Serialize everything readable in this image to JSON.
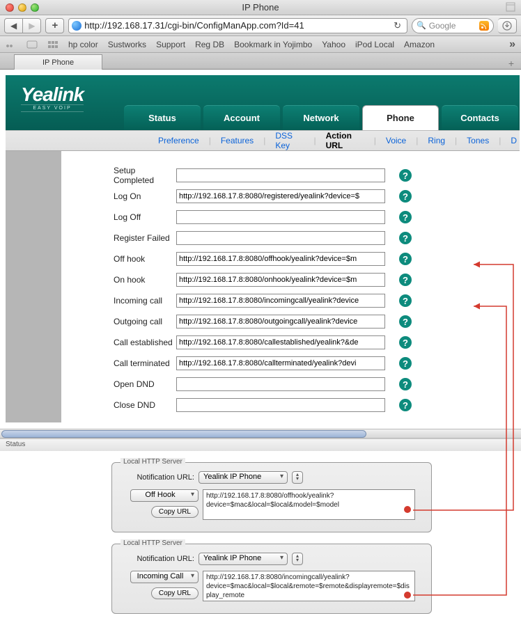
{
  "window": {
    "title": "IP Phone"
  },
  "toolbar": {
    "url": "http://192.168.17.31/cgi-bin/ConfigManApp.com?Id=41",
    "search_placeholder": "Google"
  },
  "bookmarks": {
    "items": [
      "hp color",
      "Sustworks",
      "Support",
      "Reg DB",
      "Bookmark in Yojimbo",
      "Yahoo",
      "iPod Local",
      "Amazon"
    ]
  },
  "browser_tab": {
    "label": "IP Phone"
  },
  "page": {
    "logo_text": "Yealink",
    "logo_sub": "EASY VOIP",
    "main_tabs": {
      "items": [
        {
          "label": "Status",
          "active": false
        },
        {
          "label": "Account",
          "active": false
        },
        {
          "label": "Network",
          "active": false
        },
        {
          "label": "Phone",
          "active": true
        },
        {
          "label": "Contacts",
          "active": false
        }
      ]
    },
    "sub_tabs": {
      "items": [
        {
          "label": "Preference",
          "active": false
        },
        {
          "label": "Features",
          "active": false
        },
        {
          "label": "DSS Key",
          "active": false
        },
        {
          "label": "Action URL",
          "active": true
        },
        {
          "label": "Voice",
          "active": false
        },
        {
          "label": "Ring",
          "active": false
        },
        {
          "label": "Tones",
          "active": false
        },
        {
          "label": "D",
          "active": false
        }
      ]
    },
    "form_rows": [
      {
        "label": "Setup Completed",
        "value": ""
      },
      {
        "label": "Log On",
        "value": "http://192.168.17.8:8080/registered/yealink?device=$"
      },
      {
        "label": "Log Off",
        "value": ""
      },
      {
        "label": "Register Failed",
        "value": ""
      },
      {
        "label": "Off hook",
        "value": "http://192.168.17.8:8080/offhook/yealink?device=$m"
      },
      {
        "label": "On hook",
        "value": "http://192.168.17.8:8080/onhook/yealink?device=$m"
      },
      {
        "label": "Incoming call",
        "value": "http://192.168.17.8:8080/incomingcall/yealink?device"
      },
      {
        "label": "Outgoing call",
        "value": "http://192.168.17.8:8080/outgoingcall/yealink?device"
      },
      {
        "label": "Call established",
        "value": "http://192.168.17.8:8080/callestablished/yealink?&de"
      },
      {
        "label": "Call terminated",
        "value": "http://192.168.17.8:8080/callterminated/yealink?devi"
      },
      {
        "label": "Open DND",
        "value": ""
      },
      {
        "label": "Close DND",
        "value": ""
      }
    ]
  },
  "statusbar": {
    "text": "Status"
  },
  "panels": [
    {
      "title": "Local HTTP Server",
      "notif_label": "Notification URL:",
      "notif_select": "Yealink IP Phone",
      "event_select": "Off Hook",
      "copy_label": "Copy URL",
      "url_text": "http://192.168.17.8:8080/offhook/yealink?device=$mac&local=$local&model=$model"
    },
    {
      "title": "Local HTTP Server",
      "notif_label": "Notification URL:",
      "notif_select": "Yealink IP Phone",
      "event_select": "Incoming Call",
      "copy_label": "Copy URL",
      "url_text": "http://192.168.17.8:8080/incomingcall/yealink?device=$mac&local=$local&remote=$remote&displayremote=$display_remote"
    }
  ]
}
